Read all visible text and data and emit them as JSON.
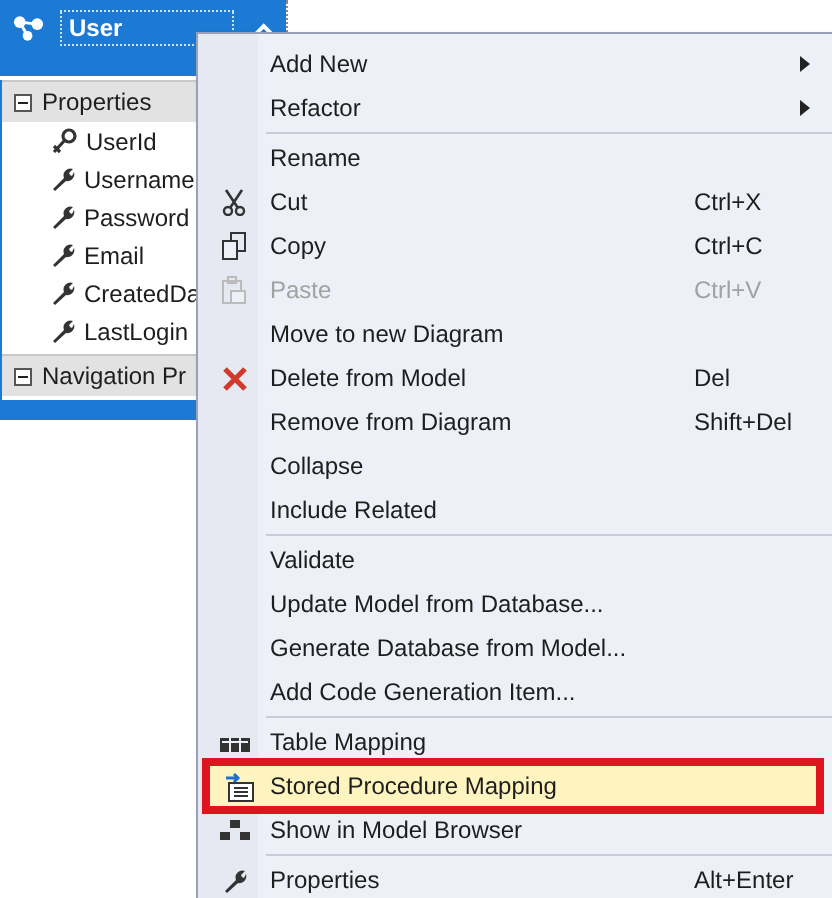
{
  "entity": {
    "title": "User",
    "expanded": true,
    "sections": [
      {
        "title": "Properties",
        "expanded": true,
        "items": [
          {
            "name": "UserId",
            "kind": "key"
          },
          {
            "name": "Username",
            "kind": "property"
          },
          {
            "name": "Password",
            "kind": "property"
          },
          {
            "name": "Email",
            "kind": "property"
          },
          {
            "name": "CreatedDa",
            "kind": "property"
          },
          {
            "name": "LastLogin",
            "kind": "property"
          }
        ]
      },
      {
        "title": "Navigation Pr",
        "expanded": true
      }
    ]
  },
  "context_menu": {
    "groups": [
      [
        {
          "label": "Add New",
          "submenu": true,
          "disabled": false,
          "selected": false
        },
        {
          "label": "Refactor",
          "submenu": true,
          "disabled": false,
          "selected": false
        }
      ],
      [
        {
          "label": "Rename",
          "disabled": false,
          "selected": false
        },
        {
          "label": "Cut",
          "shortcut": "Ctrl+X",
          "disabled": false,
          "selected": false
        },
        {
          "label": "Copy",
          "shortcut": "Ctrl+C",
          "disabled": false,
          "selected": false
        },
        {
          "label": "Paste",
          "shortcut": "Ctrl+V",
          "disabled": true,
          "selected": false
        },
        {
          "label": "Move to new Diagram",
          "disabled": false,
          "selected": false
        },
        {
          "label": "Delete from Model",
          "shortcut": "Del",
          "disabled": false,
          "selected": false
        },
        {
          "label": "Remove from Diagram",
          "shortcut": "Shift+Del",
          "disabled": false,
          "selected": false
        },
        {
          "label": "Collapse",
          "disabled": false,
          "selected": false
        },
        {
          "label": "Include Related",
          "disabled": false,
          "selected": false
        }
      ],
      [
        {
          "label": "Validate",
          "disabled": false,
          "selected": false
        },
        {
          "label": "Update Model from Database...",
          "disabled": false,
          "selected": false
        },
        {
          "label": "Generate Database from Model...",
          "disabled": false,
          "selected": false
        },
        {
          "label": "Add Code Generation Item...",
          "disabled": false,
          "selected": false
        }
      ],
      [
        {
          "label": "Table Mapping",
          "disabled": false,
          "selected": false
        },
        {
          "label": "Stored Procedure Mapping",
          "disabled": false,
          "selected": true
        },
        {
          "label": "Show in Model Browser",
          "disabled": false,
          "selected": false
        }
      ],
      [
        {
          "label": "Properties",
          "shortcut": "Alt+Enter",
          "disabled": false,
          "selected": false
        }
      ]
    ]
  }
}
